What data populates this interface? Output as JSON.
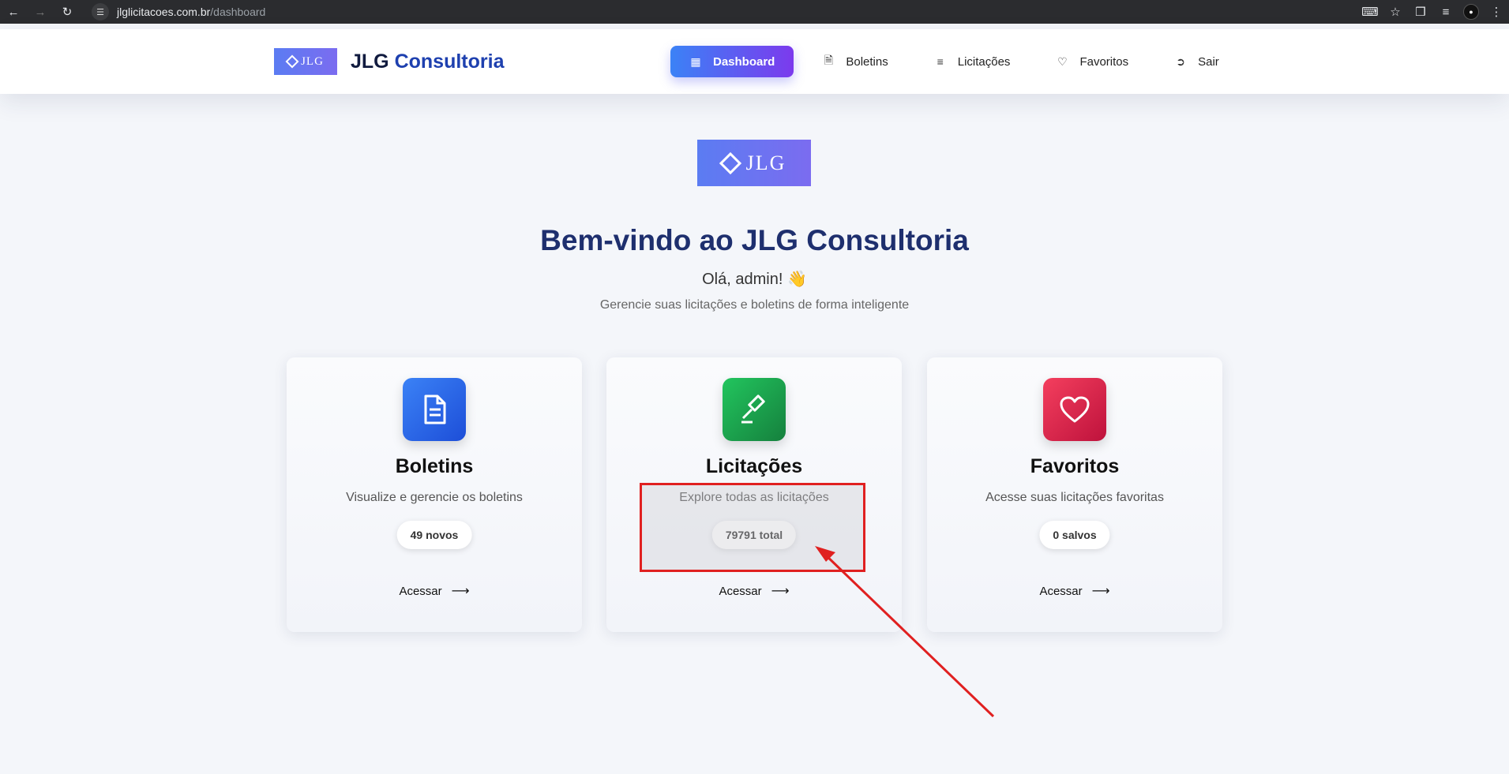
{
  "browser": {
    "url_host": "jlglicitacoes.com.br",
    "url_path": "/dashboard"
  },
  "header": {
    "brand_logo_text": "JLG",
    "brand_name_part1": "JLG ",
    "brand_name_part2": "Consultoria",
    "nav": [
      {
        "label": "Dashboard",
        "icon": "grid-icon"
      },
      {
        "label": "Boletins",
        "icon": "document-icon"
      },
      {
        "label": "Licitações",
        "icon": "list-icon"
      },
      {
        "label": "Favoritos",
        "icon": "heart-icon"
      },
      {
        "label": "Sair",
        "icon": "logout-icon"
      }
    ]
  },
  "hero": {
    "logo_text": "JLG",
    "title": "Bem-vindo ao JLG Consultoria",
    "greeting": "Olá, admin! 👋",
    "subtitle": "Gerencie suas licitações e boletins de forma inteligente"
  },
  "cards": [
    {
      "title": "Boletins",
      "description": "Visualize e gerencie os boletins",
      "badge": "49 novos",
      "action": "Acessar",
      "icon": "document-icon",
      "color_from": "#3b82f6",
      "color_to": "#1d4ed8"
    },
    {
      "title": "Licitações",
      "description": "Explore todas as licitações",
      "badge": "79791 total",
      "action": "Acessar",
      "icon": "gavel-icon",
      "color_from": "#22c55e",
      "color_to": "#15803d"
    },
    {
      "title": "Favoritos",
      "description": "Acesse suas licitações favoritas",
      "badge": "0 salvos",
      "action": "Acessar",
      "icon": "heart-icon",
      "color_from": "#f43f5e",
      "color_to": "#be123c"
    }
  ],
  "colors": {
    "annotation": "#e02020",
    "title": "#1e2f6e",
    "accent": "#1e40af"
  }
}
